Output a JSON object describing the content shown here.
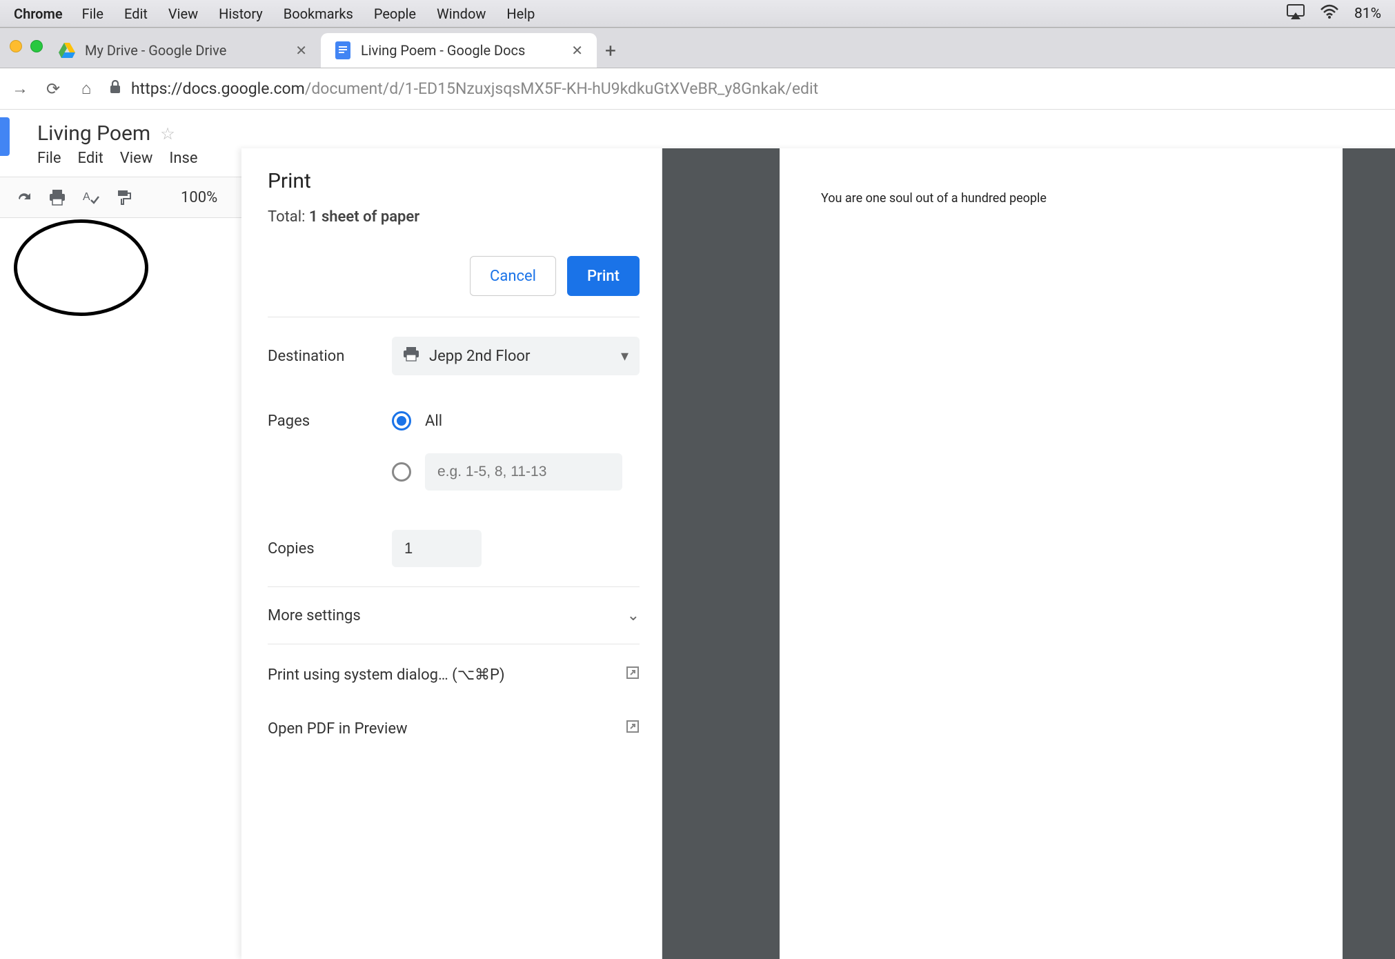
{
  "macos": {
    "app": "Chrome",
    "menus": [
      "File",
      "Edit",
      "View",
      "History",
      "Bookmarks",
      "People",
      "Window",
      "Help"
    ],
    "battery": "81%"
  },
  "tabs": [
    {
      "title": "My Drive - Google Drive",
      "active": false
    },
    {
      "title": "Living Poem - Google Docs",
      "active": true
    }
  ],
  "address_bar": {
    "protocol_host": "https://docs.google.com",
    "path": "/document/d/1-ED15NzuxjsqsMX5F-KH-hU9kdkuGtXVeBR_y8Gnkak/edit"
  },
  "docs": {
    "title": "Living Poem",
    "menus": [
      "File",
      "Edit",
      "View",
      "Inse"
    ],
    "zoom": "100%"
  },
  "print_dialog": {
    "title": "Print",
    "total_prefix": "Total: ",
    "total_bold": "1 sheet of paper",
    "cancel": "Cancel",
    "print": "Print",
    "destination_label": "Destination",
    "destination_value": "Jepp 2nd Floor",
    "pages_label": "Pages",
    "pages_all": "All",
    "pages_custom_placeholder": "e.g. 1-5, 8, 11-13",
    "copies_label": "Copies",
    "copies_value": "1",
    "more_settings": "More settings",
    "system_dialog": "Print using system dialog… (⌥⌘P)",
    "open_pdf": "Open PDF in Preview"
  },
  "preview_text": "You are one soul out of a hundred people"
}
